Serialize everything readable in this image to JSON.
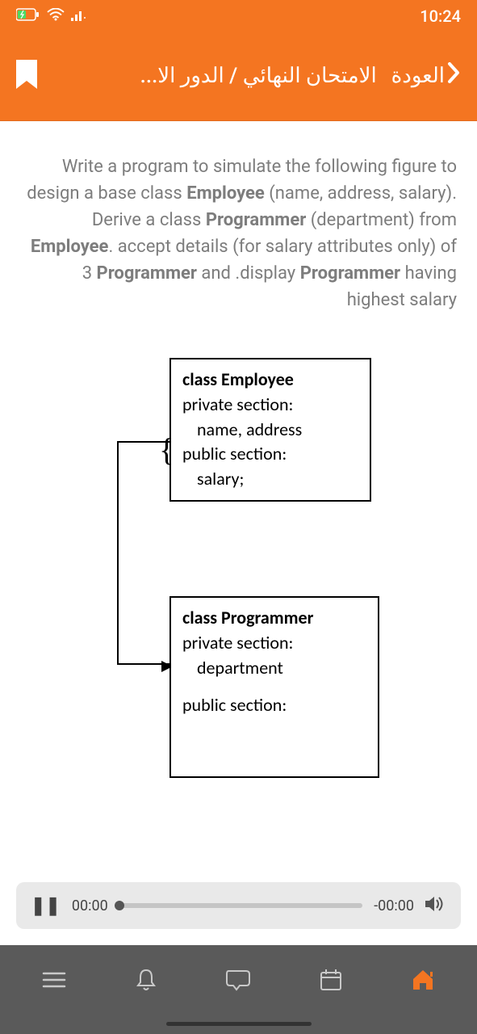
{
  "status": {
    "time": "10:24"
  },
  "header": {
    "back_label": "العودة",
    "title": "الامتحان النهائي / الدور الا..."
  },
  "question": {
    "html": "Write a program to simulate the following figure to design a base class <b>Employee</b> (name, address, salary). Derive a class <b>Programmer</b> (department) from <b>Employee</b>. accept details (for salary attributes only) of 3 <b>Programmer</b> and .display <b>Programmer</b> having highest salary"
  },
  "diagram": {
    "employee": {
      "title": "class Employee",
      "l1": "private section:",
      "l2": "name, address",
      "l3": "public section:",
      "l4": "salary;"
    },
    "programmer": {
      "title": "class Programmer",
      "l1": "private section:",
      "l2": "department",
      "l3": "public section:"
    }
  },
  "audio": {
    "current": "00:00",
    "remaining": "-00:00"
  }
}
